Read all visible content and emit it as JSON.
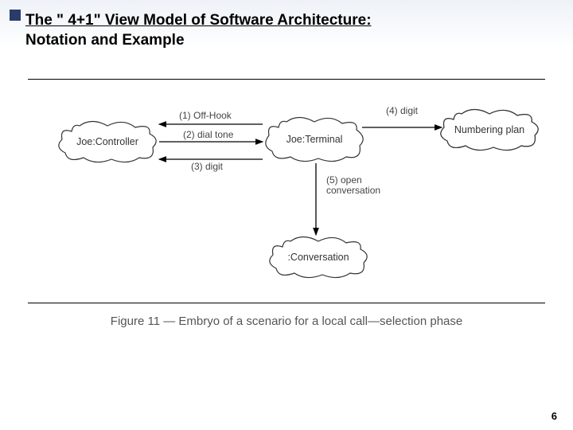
{
  "header": {
    "title_line1": "The \" 4+1\" View Model of Software Architecture:",
    "title_line2": "Notation and Example"
  },
  "diagram": {
    "nodes": {
      "controller": "Joe:Controller",
      "terminal": "Joe:Terminal",
      "numbering": "Numbering plan",
      "conversation": ":Conversation"
    },
    "connections": {
      "c1": "(1) Off-Hook",
      "c2": "(2) dial tone",
      "c3": "(3) digit",
      "c4": "(4) digit",
      "c5": "(5) open\nconversation",
      "c5_l1": "(5) open",
      "c5_l2": "conversation"
    },
    "caption": "Figure 11 — Embryo of a scenario for a local call—selection phase"
  },
  "page": {
    "number": "6"
  }
}
